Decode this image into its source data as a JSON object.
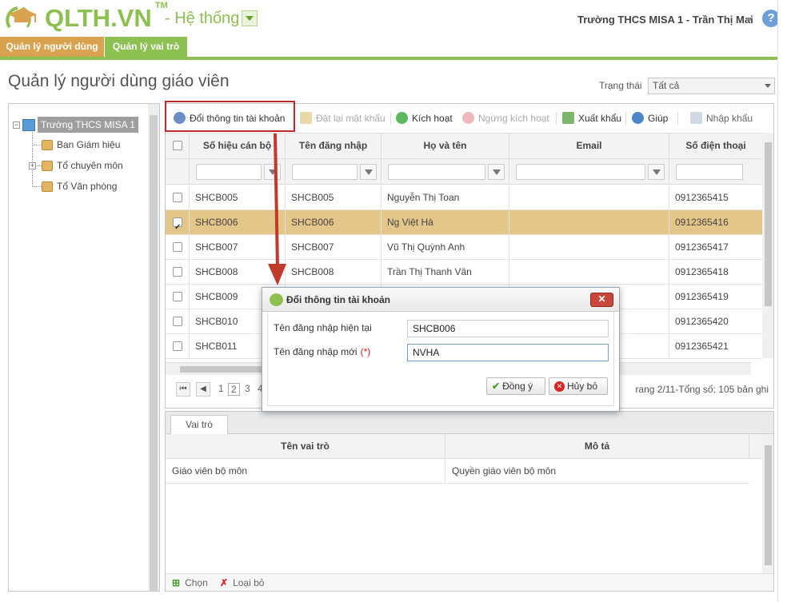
{
  "header": {
    "logo_text": "QLTH.VN",
    "logo_tm": "TM",
    "system_label": "- Hệ thống",
    "user_label": "Trường THCS MISA 1 - Trần Thị Mai",
    "help": "?"
  },
  "tabs": [
    {
      "label": "Quản lý người dùng"
    },
    {
      "label": "Quản lý vai trò"
    }
  ],
  "page": {
    "title": "Quản lý người dùng giáo viên",
    "status_label": "Trạng thái",
    "status_value": "Tất cả"
  },
  "tree": {
    "root": "Trường THCS MISA 1",
    "children": [
      "Ban Giám hiệu",
      "Tổ chuyên môn",
      "Tổ Văn phòng"
    ],
    "expanders": [
      "−",
      "+"
    ]
  },
  "toolbar": {
    "change_account": "Đổi thông tin tài khoản",
    "reset_password": "Đặt lại mật khẩu",
    "activate": "Kích hoạt",
    "deactivate": "Ngừng kích hoạt",
    "export": "Xuất khẩu",
    "help": "Giúp",
    "import": "Nhập khẩu"
  },
  "grid": {
    "columns": [
      "Số hiệu cán bộ",
      "Tên đăng nhập",
      "Họ và tên",
      "Email",
      "Số điện thoại"
    ],
    "rows": [
      {
        "code": "SHCB005",
        "username": "SHCB005",
        "name": "Nguyễn Thị Toan",
        "email": "",
        "phone": "0912365415",
        "checked": false
      },
      {
        "code": "SHCB006",
        "username": "SHCB006",
        "name": "Ng Việt Hà",
        "email": "",
        "phone": "0912365416",
        "checked": true
      },
      {
        "code": "SHCB007",
        "username": "SHCB007",
        "name": "Vũ Thị Quỳnh Anh",
        "email": "",
        "phone": "0912365417",
        "checked": false
      },
      {
        "code": "SHCB008",
        "username": "SHCB008",
        "name": "Trần Thị Thanh Vân",
        "email": "",
        "phone": "0912365418",
        "checked": false
      },
      {
        "code": "SHCB009",
        "username": "",
        "name": "",
        "email": "",
        "phone": "0912365419",
        "checked": false
      },
      {
        "code": "SHCB010",
        "username": "",
        "name": "",
        "email": "",
        "phone": "0912365420",
        "checked": false
      },
      {
        "code": "SHCB011",
        "username": "",
        "name": "",
        "email": "",
        "phone": "0912365421",
        "checked": false
      }
    ]
  },
  "pager": {
    "first": "⏮",
    "prev": "◀",
    "pages": [
      "1",
      "2",
      "3",
      "4"
    ],
    "current": "2",
    "info": "rang 2/11-Tổng số: 105 bản ghi"
  },
  "role_panel": {
    "tab": "Vai trò",
    "columns": [
      "Tên vai trò",
      "Mô tả"
    ],
    "rows": [
      {
        "name": "Giáo viên bộ môn",
        "description": "Quyền giáo viên bộ môn"
      }
    ],
    "select_btn": "Chọn",
    "remove_btn": "Loại bỏ"
  },
  "dialog": {
    "title": "Đổi thông tin tài khoản",
    "close": "✕",
    "current_label": "Tên đăng nhập hiện tại",
    "current_value": "SHCB006",
    "new_label": "Tên đăng nhập mới",
    "required_mark": "(*)",
    "new_value": "NVHA",
    "ok": "Đồng ý",
    "cancel": "Hủy bỏ"
  },
  "icons": {
    "logo": "graduation-cap-icon",
    "ok": "check-icon",
    "cancel": "cancel-icon"
  },
  "colors": {
    "brand_green": "#8cc152",
    "tab_orange": "#d9a24e",
    "selected_row": "#e4c58a",
    "highlight_red": "#c0282d"
  }
}
